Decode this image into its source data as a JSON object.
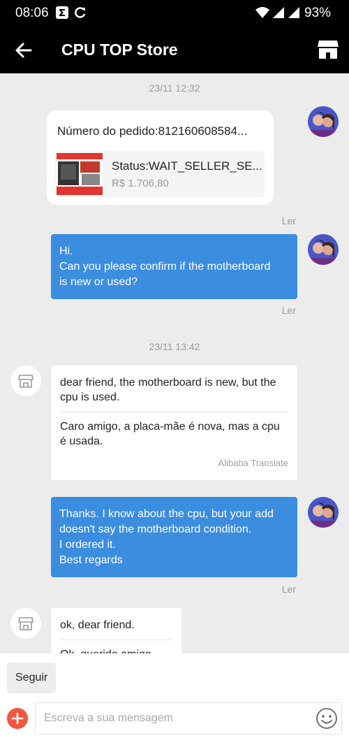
{
  "status_bar": {
    "time": "08:06",
    "battery": "93%",
    "icons": [
      "notification-sigma-icon",
      "sync-icon",
      "wifi-icon",
      "signal-icon",
      "signal-icon"
    ]
  },
  "app_bar": {
    "title": "CPU TOP Store",
    "icons": [
      "back-arrow-icon",
      "store-icon"
    ]
  },
  "chat": {
    "timestamp_1": "23/11 12:32",
    "order_card": {
      "order_number": "Número do pedido:812160608584...",
      "status": "Status:WAIT_SELLER_SE...",
      "price": "R$ 1.706,80"
    },
    "read_label_1": "Ler",
    "message_1_lines": [
      "Hi.",
      "Can you please confirm if the motherboard",
      "is new or used?"
    ],
    "read_label_2": "Ler",
    "timestamp_2": "23/11 13:42",
    "seller_message_1": {
      "original": "dear friend, the motherboard is new, but the cpu is used.",
      "translation": "Caro amigo, a placa-mãe é nova, mas a cpu é usada.",
      "credit": "Alibaba Translate"
    },
    "message_2_lines": [
      "Thanks. I know about the cpu, but your add",
      "doesn't say the motherboard condition.",
      "I ordered it.",
      "Best regards"
    ],
    "read_label_3": "Ler",
    "seller_message_2": {
      "original": "ok, dear friend.",
      "translation": "Ok, querido amigo."
    }
  },
  "footer": {
    "quick_reply": "Seguir",
    "input_placeholder": "Escreva a sua mensagem"
  },
  "colors": {
    "outgoing_bubble": "#3b8de0",
    "chat_background": "#ececec",
    "bars": "#000000",
    "plus_button": "#f0573f"
  }
}
